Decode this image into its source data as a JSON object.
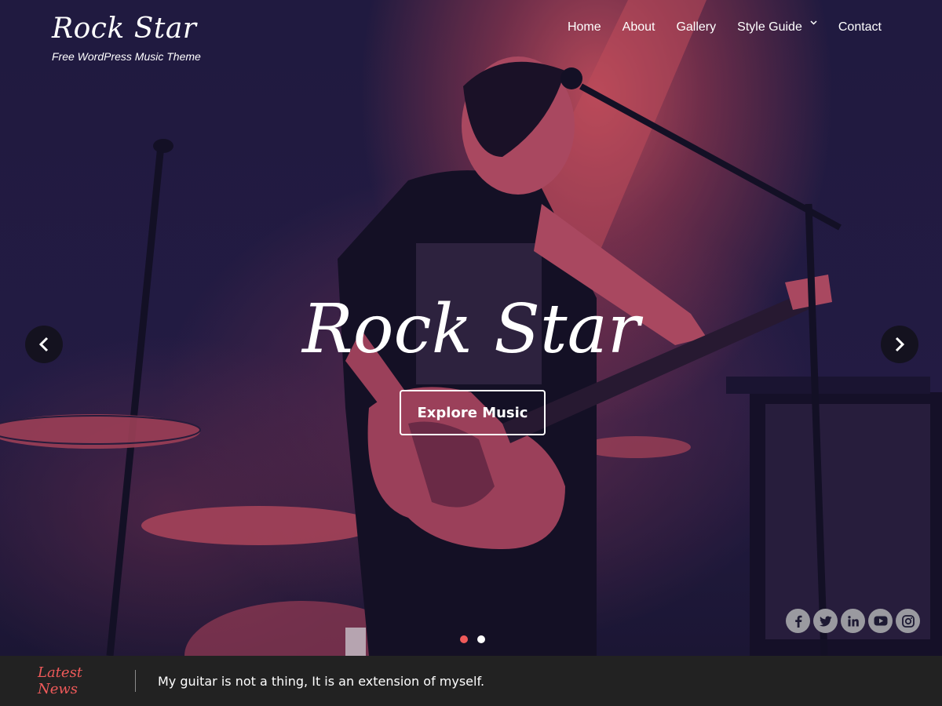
{
  "brand": {
    "title": "Rock Star",
    "tagline": "Free WordPress Music Theme"
  },
  "nav": {
    "items": [
      {
        "label": "Home",
        "has_submenu": false
      },
      {
        "label": "About",
        "has_submenu": false
      },
      {
        "label": "Gallery",
        "has_submenu": false
      },
      {
        "label": "Style Guide",
        "has_submenu": true
      },
      {
        "label": "Contact",
        "has_submenu": false
      }
    ]
  },
  "hero": {
    "title": "Rock Star",
    "cta_label": "Explore Music",
    "prev_icon": "chevron-left-icon",
    "next_icon": "chevron-right-icon",
    "slides": {
      "count": 2,
      "active_index": 0
    }
  },
  "social": {
    "icons": [
      "facebook-icon",
      "twitter-icon",
      "linkedin-icon",
      "youtube-icon",
      "instagram-icon"
    ]
  },
  "news": {
    "label": "Latest News",
    "headline": "My guitar is not a thing, It is an extension of myself."
  },
  "colors": {
    "accent": "#ef5a5a",
    "hero_tint": "#e25862",
    "news_bar": "#222222",
    "text": "#ffffff"
  }
}
